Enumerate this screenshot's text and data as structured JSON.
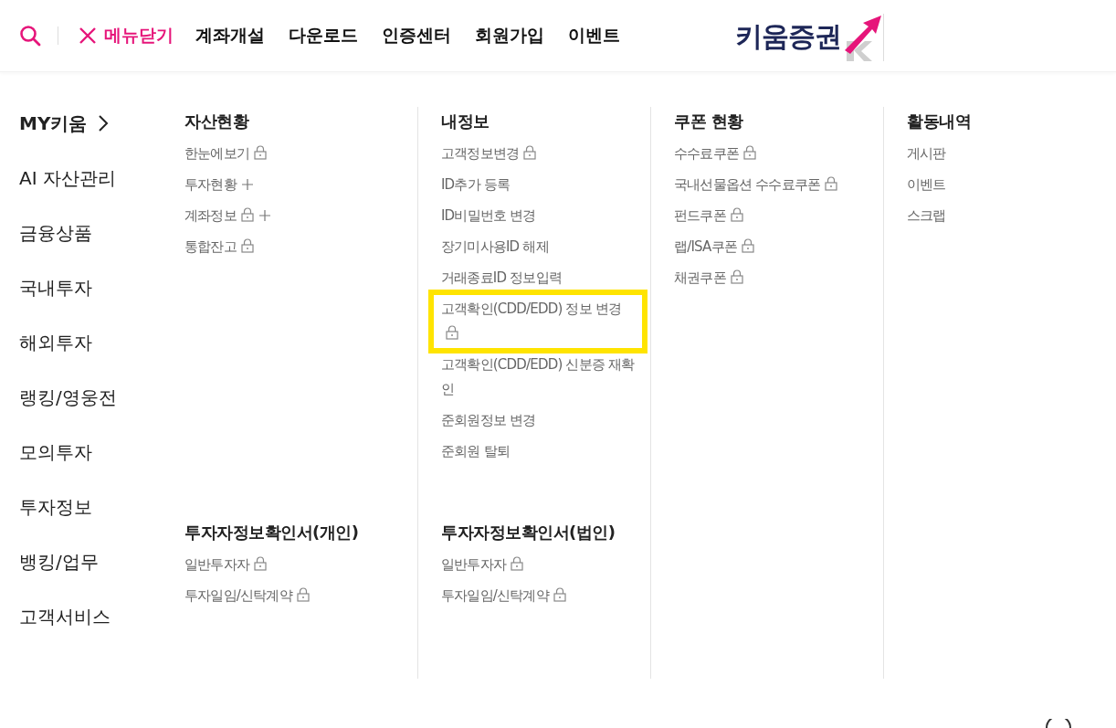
{
  "header": {
    "close_menu": "메뉴닫기",
    "links": [
      "계좌개설",
      "다운로드",
      "인증센터",
      "회원가입",
      "이벤트"
    ],
    "logo": "키움증권"
  },
  "nav": [
    {
      "label": "MY키움",
      "selected": true
    },
    {
      "label": "AI 자산관리",
      "selected": false
    },
    {
      "label": "금융상품",
      "selected": false
    },
    {
      "label": "국내투자",
      "selected": false
    },
    {
      "label": "해외투자",
      "selected": false
    },
    {
      "label": "랭킹/영웅전",
      "selected": false
    },
    {
      "label": "모의투자",
      "selected": false
    },
    {
      "label": "투자정보",
      "selected": false
    },
    {
      "label": "뱅킹/업무",
      "selected": false
    },
    {
      "label": "고객서비스",
      "selected": false
    }
  ],
  "columns": [
    {
      "groups": [
        {
          "title": "자산현황",
          "items": [
            {
              "label": "한눈에보기",
              "locked": true,
              "expandable": false
            },
            {
              "label": "투자현황",
              "locked": false,
              "expandable": true
            },
            {
              "label": "계좌정보",
              "locked": true,
              "expandable": true
            },
            {
              "label": "통합잔고",
              "locked": true,
              "expandable": false
            }
          ]
        },
        {
          "title": "투자자정보확인서(개인)",
          "items": [
            {
              "label": "일반투자자",
              "locked": true,
              "expandable": false
            },
            {
              "label": "투자일임/신탁계약",
              "locked": true,
              "expandable": false
            }
          ]
        }
      ]
    },
    {
      "groups": [
        {
          "title": "내정보",
          "items": [
            {
              "label": "고객정보변경",
              "locked": true,
              "expandable": false
            },
            {
              "label": "ID추가 등록",
              "locked": false,
              "expandable": false
            },
            {
              "label": "ID비밀번호 변경",
              "locked": false,
              "expandable": false
            },
            {
              "label": "장기미사용ID 해제",
              "locked": false,
              "expandable": false
            },
            {
              "label": "거래종료ID 정보입력",
              "locked": false,
              "expandable": false
            },
            {
              "label": "고객확인(CDD/EDD) 정보 변경",
              "locked": true,
              "expandable": false,
              "highlighted": true
            },
            {
              "label": "고객확인(CDD/EDD) 신분증 재확인",
              "locked": false,
              "expandable": false
            },
            {
              "label": "준회원정보 변경",
              "locked": false,
              "expandable": false
            },
            {
              "label": "준회원 탈퇴",
              "locked": false,
              "expandable": false
            }
          ]
        },
        {
          "title": "투자자정보확인서(법인)",
          "items": [
            {
              "label": "일반투자자",
              "locked": true,
              "expandable": false
            },
            {
              "label": "투자일임/신탁계약",
              "locked": true,
              "expandable": false
            }
          ]
        }
      ]
    },
    {
      "groups": [
        {
          "title": "쿠폰 현황",
          "items": [
            {
              "label": "수수료쿠폰",
              "locked": true,
              "expandable": false
            },
            {
              "label": "국내선물옵션 수수료쿠폰",
              "locked": true,
              "expandable": false
            },
            {
              "label": "펀드쿠폰",
              "locked": true,
              "expandable": false
            },
            {
              "label": "랩/ISA쿠폰",
              "locked": true,
              "expandable": false
            },
            {
              "label": "채권쿠폰",
              "locked": true,
              "expandable": false
            }
          ]
        }
      ]
    },
    {
      "groups": [
        {
          "title": "활동내역",
          "items": [
            {
              "label": "게시판",
              "locked": false,
              "expandable": false
            },
            {
              "label": "이벤트",
              "locked": false,
              "expandable": false
            },
            {
              "label": "스크랩",
              "locked": false,
              "expandable": false
            }
          ]
        }
      ]
    }
  ]
}
